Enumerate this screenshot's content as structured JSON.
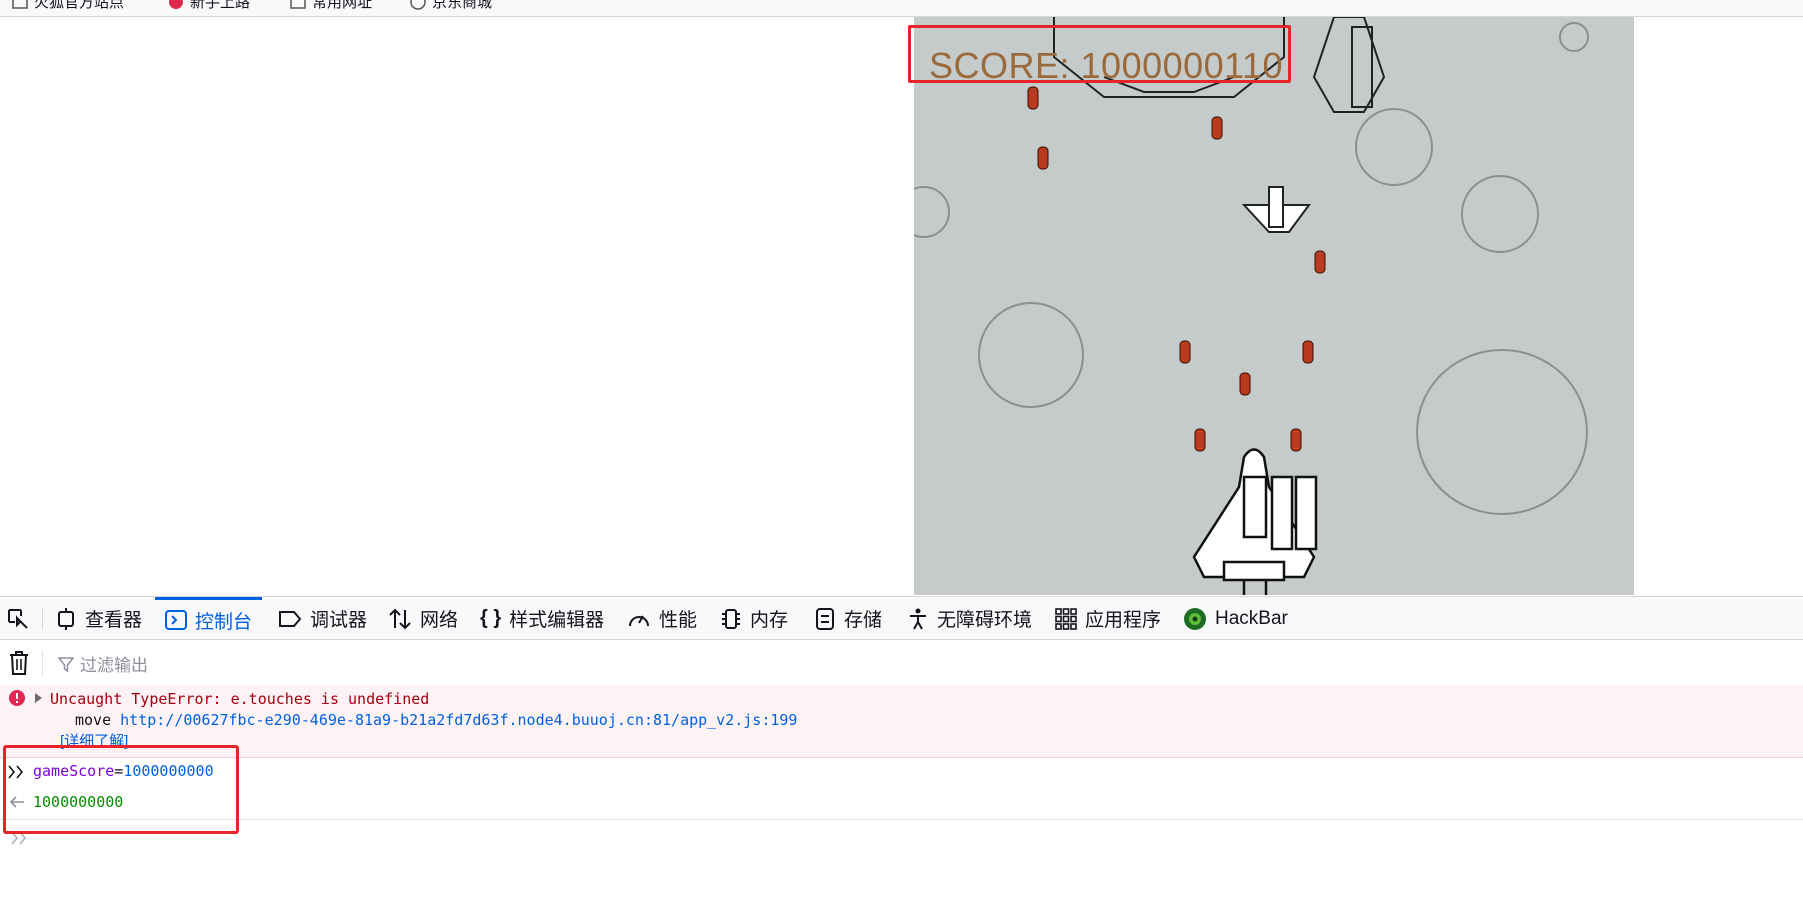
{
  "bookmarks": [
    {
      "label": "火狐官方站点",
      "icon": "folder-icon"
    },
    {
      "label": "新手上路",
      "icon": "firefox-icon"
    },
    {
      "label": "常用网址",
      "icon": "folder-icon"
    },
    {
      "label": "京东商城",
      "icon": "globe-icon"
    }
  ],
  "game": {
    "score_text": "SCORE: 1000000110"
  },
  "devtools": {
    "tabs": [
      {
        "label": "查看器",
        "icon": "inspector-icon"
      },
      {
        "label": "控制台",
        "icon": "console-icon",
        "active": true
      },
      {
        "label": "调试器",
        "icon": "debugger-icon"
      },
      {
        "label": "网络",
        "icon": "network-icon"
      },
      {
        "label": "样式编辑器",
        "icon": "style-editor-icon"
      },
      {
        "label": "性能",
        "icon": "performance-icon"
      },
      {
        "label": "内存",
        "icon": "memory-icon"
      },
      {
        "label": "存储",
        "icon": "storage-icon"
      },
      {
        "label": "无障碍环境",
        "icon": "accessibility-icon"
      },
      {
        "label": "应用程序",
        "icon": "application-icon"
      },
      {
        "label": "HackBar",
        "icon": "hackbar-icon"
      }
    ],
    "filter_placeholder": "过滤输出",
    "console": {
      "error_message": "Uncaught TypeError: e.touches is undefined",
      "error_function": "move",
      "error_link": "http://00627fbc-e290-469e-81a9-b21a2fd7d63f.node4.buuoj.cn:81/app_v2.js:199",
      "learn_more": "[详细了解]",
      "input_var": "gameScore",
      "input_op": "=",
      "input_value": "1000000000",
      "result": "1000000000"
    }
  },
  "colors": {
    "accent": "#0061e0",
    "error_bg": "#fdf2f5",
    "error_text": "#a4000f",
    "result_green": "#058b00",
    "annotation_red": "#e8242a",
    "game_bg": "#c5cbcb",
    "score_text": "#9a6a3c"
  }
}
